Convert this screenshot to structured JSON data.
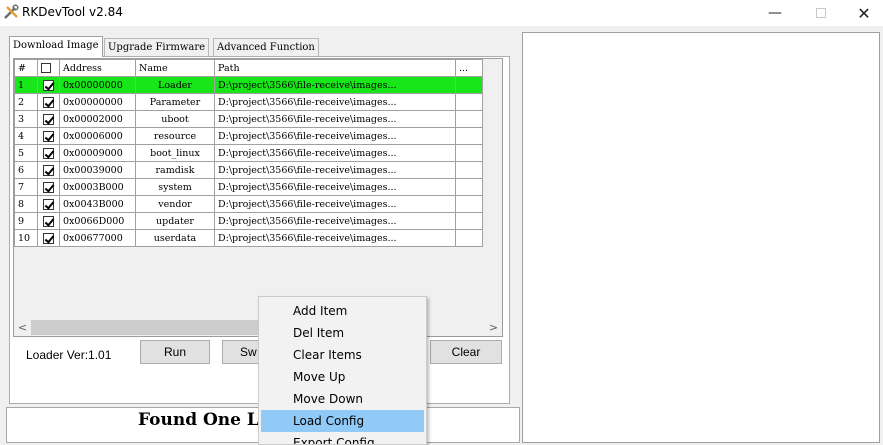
{
  "window": {
    "title": "RKDevTool v2.84",
    "minimize": "—",
    "close": "✕"
  },
  "tabs": [
    {
      "label": "Download Image",
      "active": true
    },
    {
      "label": "Upgrade Firmware",
      "active": false
    },
    {
      "label": "Advanced Function",
      "active": false
    }
  ],
  "table": {
    "headers": {
      "num": "#",
      "address": "Address",
      "name": "Name",
      "path": "Path",
      "more": "..."
    },
    "rows": [
      {
        "num": "1",
        "checked": true,
        "address": "0x00000000",
        "name": "Loader",
        "path": "D:\\project\\3566\\file-receive\\images...",
        "selected": true
      },
      {
        "num": "2",
        "checked": true,
        "address": "0x00000000",
        "name": "Parameter",
        "path": "D:\\project\\3566\\file-receive\\images...",
        "selected": false
      },
      {
        "num": "3",
        "checked": true,
        "address": "0x00002000",
        "name": "uboot",
        "path": "D:\\project\\3566\\file-receive\\images...",
        "selected": false
      },
      {
        "num": "4",
        "checked": true,
        "address": "0x00006000",
        "name": "resource",
        "path": "D:\\project\\3566\\file-receive\\images...",
        "selected": false
      },
      {
        "num": "5",
        "checked": true,
        "address": "0x00009000",
        "name": "boot_linux",
        "path": "D:\\project\\3566\\file-receive\\images...",
        "selected": false
      },
      {
        "num": "6",
        "checked": true,
        "address": "0x00039000",
        "name": "ramdisk",
        "path": "D:\\project\\3566\\file-receive\\images...",
        "selected": false
      },
      {
        "num": "7",
        "checked": true,
        "address": "0x0003B000",
        "name": "system",
        "path": "D:\\project\\3566\\file-receive\\images...",
        "selected": false
      },
      {
        "num": "8",
        "checked": true,
        "address": "0x0043B000",
        "name": "vendor",
        "path": "D:\\project\\3566\\file-receive\\images...",
        "selected": false
      },
      {
        "num": "9",
        "checked": true,
        "address": "0x0066D000",
        "name": "updater",
        "path": "D:\\project\\3566\\file-receive\\images...",
        "selected": false
      },
      {
        "num": "10",
        "checked": true,
        "address": "0x00677000",
        "name": "userdata",
        "path": "D:\\project\\3566\\file-receive\\images...",
        "selected": false
      }
    ],
    "selected_color": "#19e619"
  },
  "scrollbar": {
    "left_arrow": "<",
    "right_arrow": ">"
  },
  "footer": {
    "loader_ver": "Loader Ver:1.01",
    "run": "Run",
    "switch_partial": "Sw",
    "clear": "Clear"
  },
  "status": {
    "text": "Found One L"
  },
  "context_menu": {
    "items": [
      {
        "label": "Add Item",
        "hover": false
      },
      {
        "label": "Del Item",
        "hover": false
      },
      {
        "label": "Clear Items",
        "hover": false
      },
      {
        "label": "Move Up",
        "hover": false
      },
      {
        "label": "Move Down",
        "hover": false
      },
      {
        "label": "Load Config",
        "hover": true
      },
      {
        "label": "Export Config",
        "hover": false
      }
    ],
    "hover_color": "#91c9f7"
  }
}
